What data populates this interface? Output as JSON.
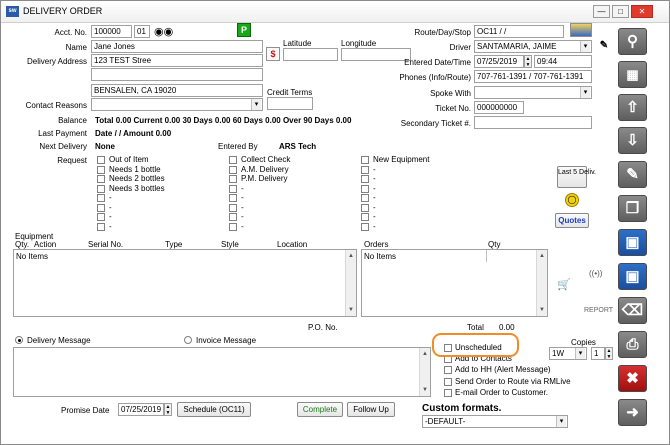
{
  "window": {
    "title": "DELIVERY ORDER",
    "app_badge": "sw"
  },
  "header": {
    "acct_label": "Acct. No.",
    "acct_no": "100000",
    "acct_suffix": "01",
    "p_badge": "P",
    "name_label": "Name",
    "name": "Jane Jones",
    "address_label": "Delivery Address",
    "address1": "123 TEST Stree",
    "address2": "",
    "city": "BENSALEN, CA  19020",
    "latitude_label": "Latitude",
    "longitude_label": "Longitude",
    "credit_terms_label": "Credit Terms",
    "contact_reasons_label": "Contact Reasons",
    "balance_label": "Balance",
    "balance_text": "Total 0.00   Current 0.00   30 Days 0.00   60 Days 0.00   Over 90 Days 0.00",
    "last_payment_label": "Last Payment",
    "last_payment_text": "Date  /  /    Amount 0.00",
    "next_delivery_label": "Next Delivery",
    "next_delivery": "None",
    "entered_by_label": "Entered By",
    "entered_by": "ARS Tech",
    "route_label": "Route/Day/Stop",
    "route": "OC11 /  /",
    "driver_label": "Driver",
    "driver": "SANTAMARIA, JAIME",
    "entered_dt_label": "Entered Date/Time",
    "entered_date": "07/25/2019",
    "entered_time": "09:44",
    "phones_label": "Phones (Info/Route)",
    "phones": "707-761-1391 / 707-761-1391",
    "spoke_with_label": "Spoke With",
    "ticket_label": "Ticket No.",
    "ticket": "000000000",
    "sec_ticket_label": "Secondary Ticket #."
  },
  "request": {
    "label": "Request",
    "col1": [
      "Out of Item",
      "Needs 1 bottle",
      "Needs 2 bottles",
      "Needs 3 bottles",
      "-",
      "-",
      "-",
      "-"
    ],
    "col2": [
      "Collect Check",
      "A.M. Delivery",
      "P.M. Delivery",
      "-",
      "-",
      "-",
      "-",
      "-"
    ],
    "col3": [
      "New Equipment",
      "-",
      "-",
      "-",
      "-",
      "-",
      "-",
      "-"
    ],
    "last5_label": "Last 5 Deliv.",
    "quotes_label": "Quotes"
  },
  "equipment": {
    "title": "Equipment",
    "headers": [
      "Qty.",
      "Action",
      "Serial No.",
      "Type",
      "Style",
      "Location"
    ],
    "empty": "No Items"
  },
  "orders": {
    "headers": [
      "Orders",
      "Qty"
    ],
    "empty": "No Items",
    "report_label": "REPORT"
  },
  "po": {
    "label": "P.O. No.",
    "total_label": "Total",
    "total": "0.00"
  },
  "messages": {
    "delivery": "Delivery Message",
    "invoice": "Invoice Message"
  },
  "options": [
    "Unscheduled",
    "Add to Contacts",
    "Add to HH (Alert Message)",
    "Send Order to Route via RMLive",
    "E-mail Order to Customer."
  ],
  "copies": {
    "label": "Copies",
    "type": "1W",
    "count": "1"
  },
  "custom_formats": {
    "label": "Custom formats.",
    "value": "-DEFAULT-"
  },
  "footer": {
    "promise_label": "Promise Date",
    "promise_date": "07/25/2019",
    "schedule_btn": "Schedule (OC11)",
    "complete_btn": "Complete",
    "followup_btn": "Follow Up"
  },
  "sidebar": [
    "search-icon",
    "grid-icon",
    "arrow-up-icon",
    "arrow-down-icon",
    "edit-icon",
    "copy-icon",
    "save-new-icon",
    "save-icon",
    "trash-icon",
    "print-icon",
    "cancel-icon",
    "exit-icon"
  ],
  "colors": {
    "highlight": "#f28c28",
    "link": "#1a3cc8",
    "green_link": "#1a7a1a"
  }
}
